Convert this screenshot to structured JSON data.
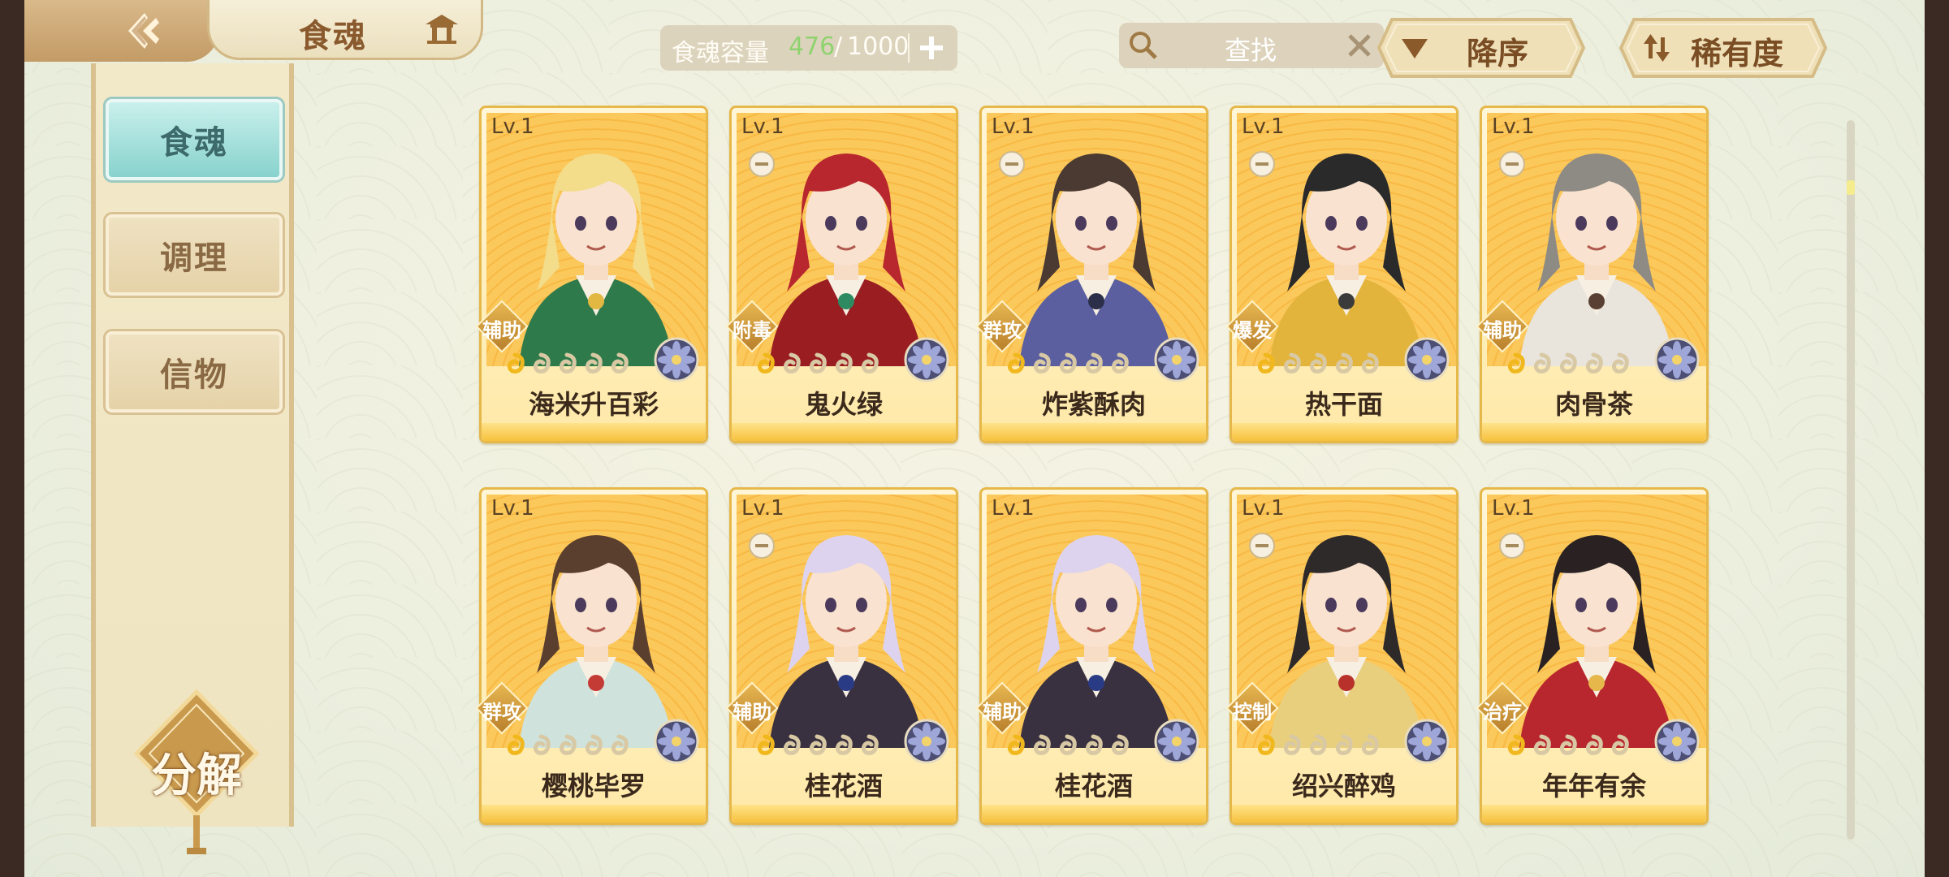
{
  "header": {
    "title": "食魂",
    "capacity_label": "食魂容量",
    "capacity_current": "476",
    "capacity_sep": "/",
    "capacity_max": "1000",
    "search_placeholder": "查找",
    "sort_order_label": "降序",
    "sort_key_label": "稀有度"
  },
  "sidebar": {
    "items": [
      {
        "label": "食魂",
        "active": true
      },
      {
        "label": "调理",
        "active": false
      },
      {
        "label": "信物",
        "active": false
      }
    ],
    "decompose_label": "分解"
  },
  "cards": [
    {
      "level": "Lv.1",
      "role": "辅助",
      "name": "海米升百彩",
      "hair": "#f3dc8a",
      "outfit": "#2f7a4a",
      "accent": "#e3b842",
      "has_tag": false
    },
    {
      "level": "Lv.1",
      "role": "附毒",
      "name": "鬼火绿",
      "hair": "#b8262e",
      "outfit": "#9a1d22",
      "accent": "#2e8a61",
      "has_tag": true
    },
    {
      "level": "Lv.1",
      "role": "群攻",
      "name": "炸紫酥肉",
      "hair": "#4a3a32",
      "outfit": "#5b5fa0",
      "accent": "#2b2f4a",
      "has_tag": true
    },
    {
      "level": "Lv.1",
      "role": "爆发",
      "name": "热干面",
      "hair": "#2a2a2a",
      "outfit": "#e2b43c",
      "accent": "#3b3b3b",
      "has_tag": true
    },
    {
      "level": "Lv.1",
      "role": "辅助",
      "name": "肉骨茶",
      "hair": "#8e8a84",
      "outfit": "#e9e4dc",
      "accent": "#5a4032",
      "has_tag": true
    },
    {
      "level": "Lv.1",
      "role": "群攻",
      "name": "樱桃毕罗",
      "hair": "#5a3f2e",
      "outfit": "#cfe3dc",
      "accent": "#c43a34",
      "has_tag": false
    },
    {
      "level": "Lv.1",
      "role": "辅助",
      "name": "桂花酒",
      "hair": "#ddd3ee",
      "outfit": "#3a3140",
      "accent": "#2a3b86",
      "has_tag": true
    },
    {
      "level": "Lv.1",
      "role": "辅助",
      "name": "桂花酒",
      "hair": "#ddd3ee",
      "outfit": "#3a3140",
      "accent": "#2a3b86",
      "has_tag": false
    },
    {
      "level": "Lv.1",
      "role": "控制",
      "name": "绍兴醉鸡",
      "hair": "#2e2a2a",
      "outfit": "#e8cf7e",
      "accent": "#b8322b",
      "has_tag": true
    },
    {
      "level": "Lv.1",
      "role": "治疗",
      "name": "年年有余",
      "hair": "#2a2222",
      "outfit": "#b8262e",
      "accent": "#e6b74a",
      "has_tag": true
    }
  ],
  "card_stars": 1,
  "card_star_slots": 5
}
